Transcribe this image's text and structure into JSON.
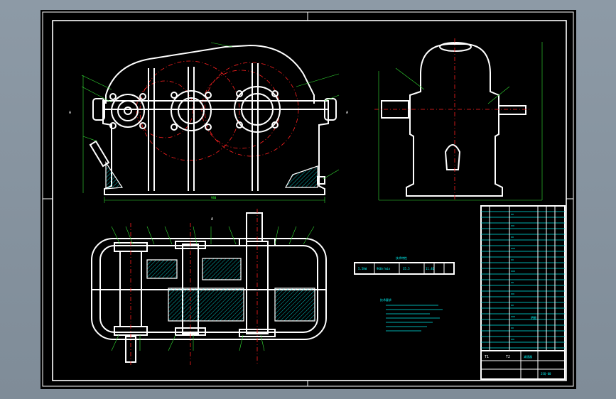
{
  "drawing": {
    "gear_table_title": "技术特性",
    "gear_table": [
      "5.5kW",
      "960r/min",
      "35.5",
      "11.46"
    ],
    "notes_label": "技术要求",
    "part_list_label": "明细",
    "title_block": {
      "name": "减速器",
      "drawing_no": "JSQ-00",
      "label_left": "T1",
      "label_mid": "T2"
    },
    "dim_front": "980",
    "dim_top": "A"
  },
  "colors": {
    "background": "#000000",
    "outline": "#ffffff",
    "centerline": "#ff2020",
    "dimension": "#34e034",
    "annotation": "#00e6e6",
    "window_gradient": "#8d9aa6"
  }
}
